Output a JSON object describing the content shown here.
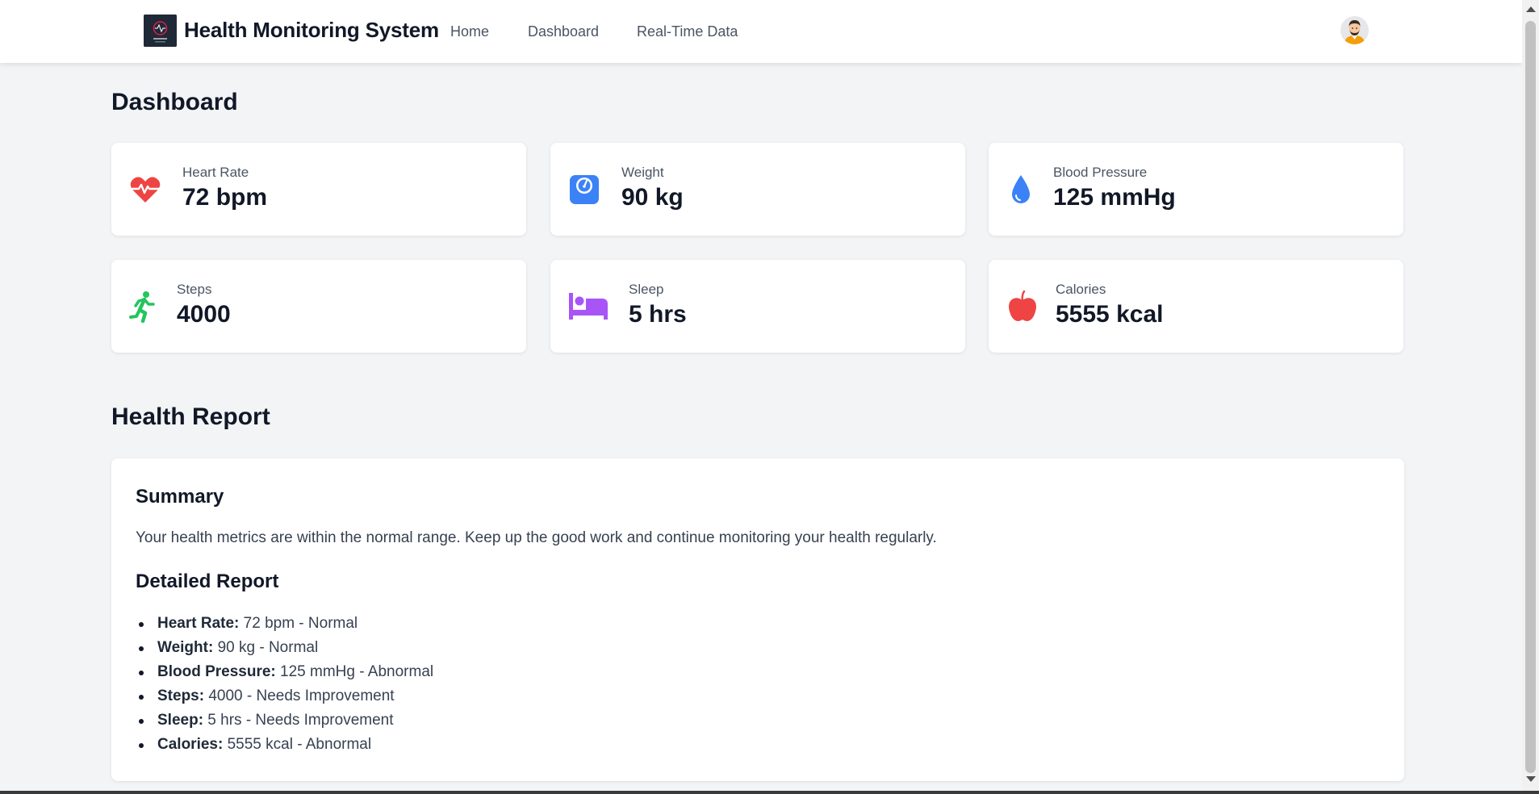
{
  "nav": {
    "brand": "Health Monitoring System",
    "links": [
      "Home",
      "Dashboard",
      "Real-Time Data"
    ]
  },
  "dashboard": {
    "title": "Dashboard",
    "cards": [
      {
        "label": "Heart Rate",
        "value": "72 bpm",
        "icon": "heart-pulse-icon",
        "color": "#ef4444"
      },
      {
        "label": "Weight",
        "value": "90 kg",
        "icon": "weight-scale-icon",
        "color": "#3b82f6"
      },
      {
        "label": "Blood Pressure",
        "value": "125 mmHg",
        "icon": "droplet-icon",
        "color": "#3b82f6"
      },
      {
        "label": "Steps",
        "value": "4000",
        "icon": "running-person-icon",
        "color": "#22c55e"
      },
      {
        "label": "Sleep",
        "value": "5 hrs",
        "icon": "bed-icon",
        "color": "#a855f7"
      },
      {
        "label": "Calories",
        "value": "5555 kcal",
        "icon": "apple-icon",
        "color": "#ef4444"
      }
    ]
  },
  "report": {
    "title": "Health Report",
    "summary_heading": "Summary",
    "summary_text": "Your health metrics are within the normal range. Keep up the good work and continue monitoring your health regularly.",
    "detail_heading": "Detailed Report",
    "items": [
      {
        "label": "Heart Rate:",
        "text": " 72 bpm - Normal"
      },
      {
        "label": "Weight:",
        "text": " 90 kg - Normal"
      },
      {
        "label": "Blood Pressure:",
        "text": " 125 mmHg - Abnormal"
      },
      {
        "label": "Steps:",
        "text": " 4000 - Needs Improvement"
      },
      {
        "label": "Sleep:",
        "text": " 5 hrs - Needs Improvement"
      },
      {
        "label": "Calories:",
        "text": " 5555 kcal - Abnormal"
      }
    ]
  }
}
